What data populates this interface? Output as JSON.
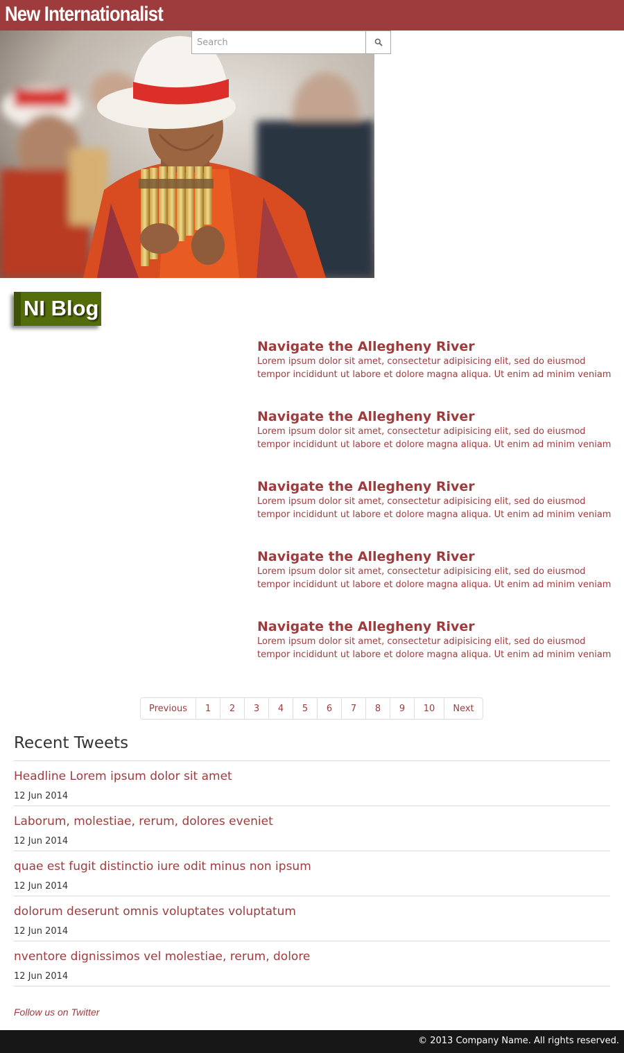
{
  "header": {
    "brand": "New Internationalist",
    "brand_color": "#9e3b3d"
  },
  "search": {
    "placeholder": "Search",
    "button_icon": "search-icon"
  },
  "hero": {
    "image": "panpipe-player-photo"
  },
  "blog": {
    "badge": "NI Blog",
    "badge_color": "#546d0b",
    "posts": [
      {
        "title": "Navigate the Allegheny River",
        "excerpt": "Lorem ipsum dolor sit amet, consectetur adipisicing elit, sed do eiusmod tempor incididunt ut labore et dolore magna aliqua. Ut enim ad minim veniam"
      },
      {
        "title": "Navigate the Allegheny River",
        "excerpt": "Lorem ipsum dolor sit amet, consectetur adipisicing elit, sed do eiusmod tempor incididunt ut labore et dolore magna aliqua. Ut enim ad minim veniam"
      },
      {
        "title": "Navigate the Allegheny River",
        "excerpt": "Lorem ipsum dolor sit amet, consectetur adipisicing elit, sed do eiusmod tempor incididunt ut labore et dolore magna aliqua. Ut enim ad minim veniam"
      },
      {
        "title": "Navigate the Allegheny River",
        "excerpt": "Lorem ipsum dolor sit amet, consectetur adipisicing elit, sed do eiusmod tempor incididunt ut labore et dolore magna aliqua. Ut enim ad minim veniam"
      },
      {
        "title": "Navigate the Allegheny River",
        "excerpt": "Lorem ipsum dolor sit amet, consectetur adipisicing elit, sed do eiusmod tempor incididunt ut labore et dolore magna aliqua. Ut enim ad minim veniam"
      }
    ]
  },
  "pagination": {
    "previous": "Previous",
    "pages": [
      "1",
      "2",
      "3",
      "4",
      "5",
      "6",
      "7",
      "8",
      "9",
      "10"
    ],
    "next": "Next"
  },
  "tweets": {
    "title": "Recent Tweets",
    "items": [
      {
        "headline": "Headline Lorem ipsum dolor sit amet",
        "date": "12 Jun 2014"
      },
      {
        "headline": "Laborum, molestiae, rerum, dolores eveniet",
        "date": "12 Jun 2014"
      },
      {
        "headline": "quae est fugit distinctio iure odit minus non ipsum",
        "date": "12 Jun 2014"
      },
      {
        "headline": "dolorum deserunt omnis voluptates voluptatum",
        "date": "12 Jun 2014"
      },
      {
        "headline": "nventore dignissimos vel molestiae, rerum, dolore",
        "date": "12 Jun 2014"
      }
    ],
    "follow": "Follow us on Twitter"
  },
  "footer": {
    "copyright": "© 2013 Company Name. All rights reserved."
  }
}
